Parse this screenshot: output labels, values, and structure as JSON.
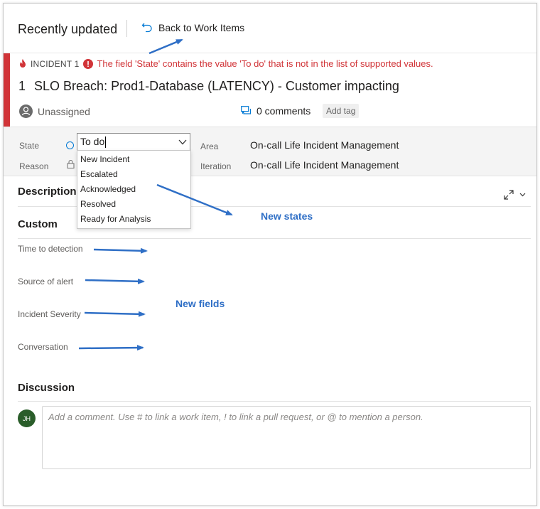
{
  "header": {
    "page_title": "Recently updated",
    "back_link": "Back to Work Items"
  },
  "work_item": {
    "type_label": "INCIDENT 1",
    "error_message": "The field 'State' contains the value 'To do' that is not in the list of supported values.",
    "id": "1",
    "title": "SLO Breach: Prod1-Database (LATENCY) - Customer impacting",
    "assigned": "Unassigned",
    "comments": "0 comments",
    "add_tag": "Add tag",
    "accent_color": "#d13438"
  },
  "fields": {
    "state_label": "State",
    "state_value": "To do",
    "reason_label": "Reason",
    "area_label": "Area",
    "area_value": "On-call Life Incident Management",
    "iteration_label": "Iteration",
    "iteration_value": "On-call Life Incident Management"
  },
  "state_options": [
    "New Incident",
    "Escalated",
    "Acknowledged",
    "Resolved",
    "Ready for Analysis"
  ],
  "sections": {
    "description": "Description",
    "custom": "Custom",
    "discussion": "Discussion"
  },
  "custom_fields": [
    "Time to detection",
    "Source of alert",
    "Incident Severity",
    "Conversation"
  ],
  "discussion": {
    "avatar_initials": "JH",
    "comment_placeholder": "Add a comment. Use # to link a work item, ! to link a pull request, or @ to mention a person."
  },
  "annotations": {
    "new_states": "New states",
    "new_fields": "New fields",
    "color": "#2f6fc6"
  }
}
